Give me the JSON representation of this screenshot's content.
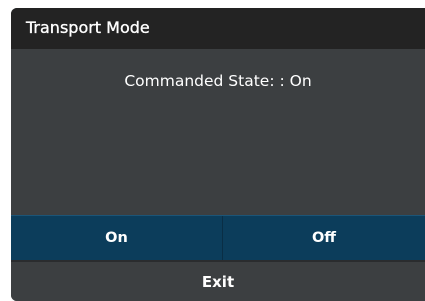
{
  "dialog": {
    "title": "Transport Mode",
    "status_text": "Commanded State: : On"
  },
  "buttons": {
    "on_label": "On",
    "off_label": "Off",
    "exit_label": "Exit"
  },
  "colors": {
    "title_bar": "#232323",
    "body": "#3c3f41",
    "button_row": "#0c3d5b",
    "text": "#ffffff"
  }
}
